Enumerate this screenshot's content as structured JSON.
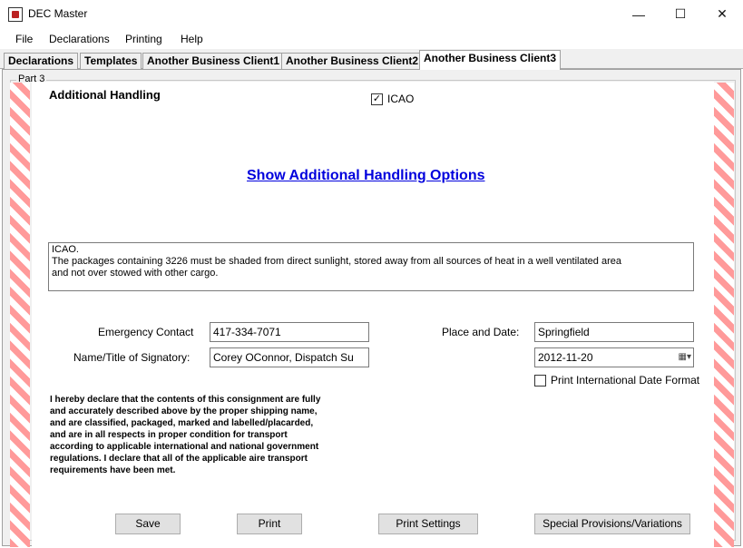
{
  "window": {
    "title": "DEC Master",
    "controls": {
      "minimize": "—",
      "maximize": "☐",
      "close": "✕"
    }
  },
  "menu": [
    "File",
    "Declarations",
    "Printing",
    "Help"
  ],
  "tabs": [
    {
      "label": "Declarations",
      "active": false
    },
    {
      "label": "Templates",
      "active": false
    },
    {
      "label": "Another Business Client1",
      "active": false
    },
    {
      "label": "Another Business Client2",
      "active": false
    },
    {
      "label": "Another Business Client3",
      "active": true
    }
  ],
  "group": {
    "label": "Part 3",
    "title": "Additional Handling",
    "icao_checkbox": {
      "label": "ICAO",
      "checked": true,
      "mark": "✓"
    },
    "show_options_link": "Show Additional Handling Options",
    "handling_text": [
      "ICAO.",
      "The packages containing 3226 must be shaded from direct sunlight, stored away from all sources of heat in a well ventilated area",
      "and not over stowed with other cargo."
    ]
  },
  "form": {
    "emergency_contact_label": "Emergency Contact",
    "emergency_contact_value": "417-334-7071",
    "signatory_label": "Name/Title of Signatory:",
    "signatory_value": "Corey OConnor, Dispatch Su",
    "place_date_label": "Place and Date:",
    "place_value": "Springfield",
    "date_value": "2012-11-20",
    "date_picker_icon": "▦▾",
    "intl_date_checkbox": {
      "label": "Print International Date Format",
      "checked": false
    }
  },
  "declaration_lines": [
    "I hereby declare that the contents of this consignment are fully",
    "and accurately described above by the proper shipping name,",
    "and are classified, packaged, marked and labelled/placarded,",
    "and are in all respects in proper condition for transport",
    "according to applicable international and national government",
    "regulations.  I declare that all of the applicable aire transport",
    "requirements have been met."
  ],
  "buttons": {
    "save": "Save",
    "print": "Print",
    "print_settings": "Print Settings",
    "special_provisions": "Special Provisions/Variations"
  },
  "colors": {
    "stripe": "#ff9a9a",
    "link": "#0000dd",
    "panel": "#f0f0f0"
  }
}
